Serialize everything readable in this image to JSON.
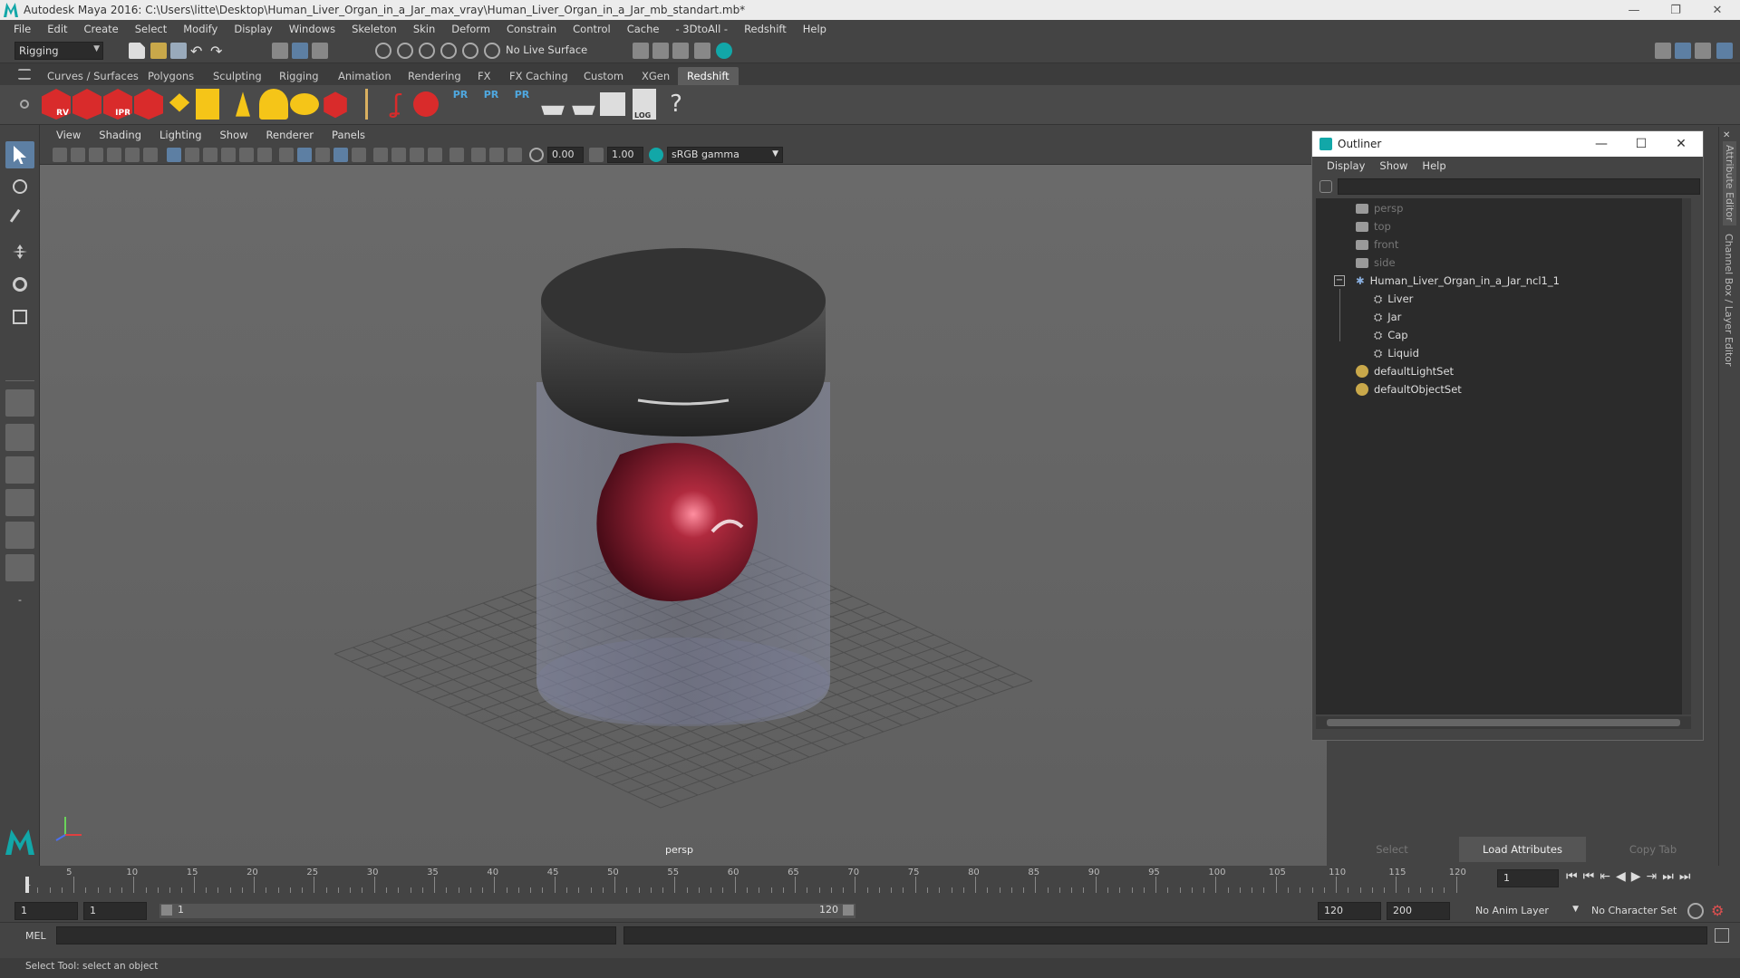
{
  "window": {
    "title": "Autodesk Maya 2016: C:\\Users\\litte\\Desktop\\Human_Liver_Organ_in_a_Jar_max_vray\\Human_Liver_Organ_in_a_Jar_mb_standart.mb*"
  },
  "menubar": [
    "File",
    "Edit",
    "Create",
    "Select",
    "Modify",
    "Display",
    "Windows",
    "Skeleton",
    "Skin",
    "Deform",
    "Constrain",
    "Control",
    "Cache",
    "- 3DtoAll -",
    "Redshift",
    "Help"
  ],
  "status": {
    "menu_set": "Rigging",
    "live_surface": "No Live Surface"
  },
  "shelf_tabs": [
    "Curves / Surfaces",
    "Polygons",
    "Sculpting",
    "Rigging",
    "Animation",
    "Rendering",
    "FX",
    "FX Caching",
    "Custom",
    "XGen",
    "Redshift"
  ],
  "shelf_active": "Redshift",
  "shelf_labels": {
    "rv": "RV",
    "ipr": "IPR",
    "pr1": "PR",
    "pr2": "PR",
    "pr3": "PR",
    "log": "LOG",
    "help": "?"
  },
  "viewport": {
    "menus": [
      "View",
      "Shading",
      "Lighting",
      "Show",
      "Renderer",
      "Panels"
    ],
    "exposure": "0.00",
    "gamma": "1.00",
    "color_space": "sRGB gamma",
    "camera_label": "persp"
  },
  "outliner": {
    "title": "Outliner",
    "menus": [
      "Display",
      "Show",
      "Help"
    ],
    "items": [
      {
        "label": "persp",
        "type": "camera"
      },
      {
        "label": "top",
        "type": "camera"
      },
      {
        "label": "front",
        "type": "camera"
      },
      {
        "label": "side",
        "type": "camera"
      },
      {
        "label": "Human_Liver_Organ_in_a_Jar_ncl1_1",
        "type": "group"
      },
      {
        "label": "Liver",
        "type": "mesh"
      },
      {
        "label": "Jar",
        "type": "mesh"
      },
      {
        "label": "Cap",
        "type": "mesh"
      },
      {
        "label": "Liquid",
        "type": "mesh"
      },
      {
        "label": "defaultLightSet",
        "type": "set"
      },
      {
        "label": "defaultObjectSet",
        "type": "set"
      }
    ],
    "collapse_symbol": "−"
  },
  "right_panel": {
    "buttons": [
      "Select",
      "Load Attributes",
      "Copy Tab"
    ],
    "side_tabs": [
      "Attribute Editor",
      "Channel Box / Layer Editor"
    ]
  },
  "timeline": {
    "ticks": [
      "5",
      "10",
      "15",
      "20",
      "25",
      "30",
      "35",
      "40",
      "45",
      "50",
      "55",
      "60",
      "65",
      "70",
      "75",
      "80",
      "85",
      "90",
      "95",
      "100",
      "105",
      "110",
      "115",
      "120"
    ],
    "start_label": "1",
    "current_frame": "1"
  },
  "range": {
    "start": "1",
    "playback_start": "1",
    "slider_start": "1",
    "slider_end": "120",
    "playback_end": "120",
    "end": "200",
    "anim_layer": "No Anim Layer",
    "character_set": "No Character Set"
  },
  "command_line": {
    "lang": "MEL"
  },
  "help_line": "Select Tool: select an object",
  "colors": {
    "accent": "#12a7a8",
    "redshift": "#d92b2b",
    "selected_tool": "#5d7fa3"
  }
}
